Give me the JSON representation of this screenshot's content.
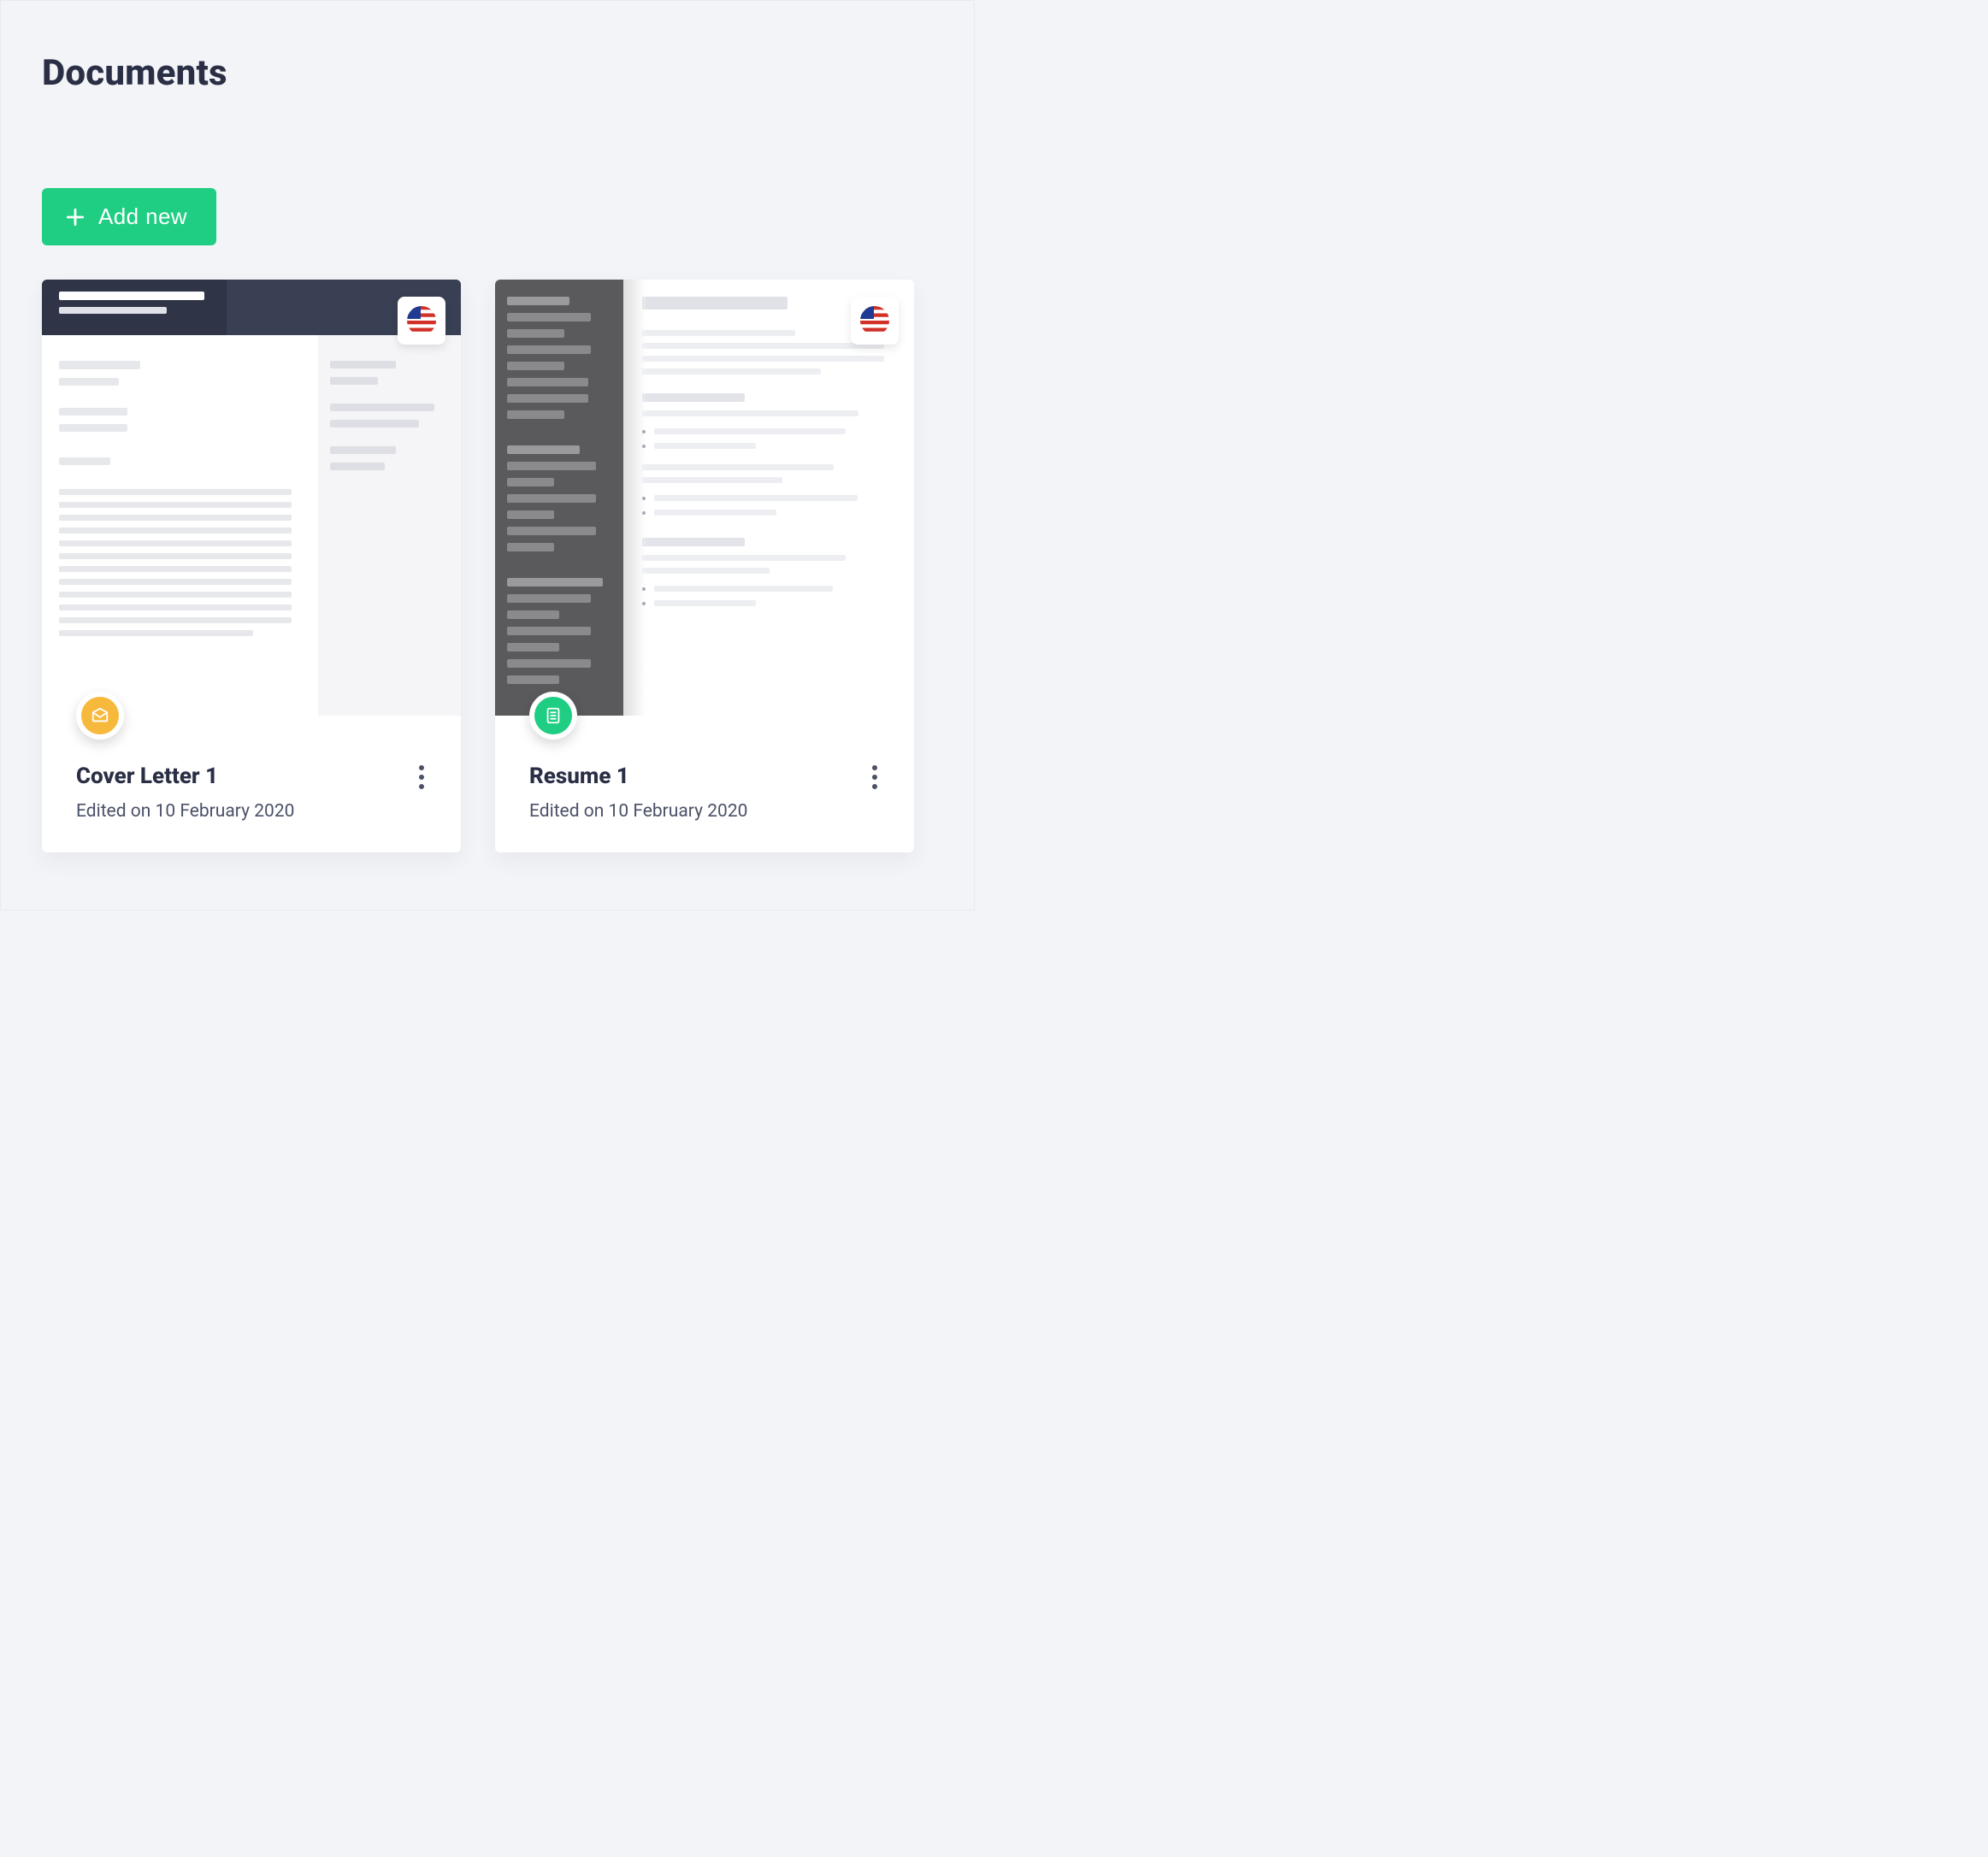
{
  "page": {
    "title": "Documents"
  },
  "actions": {
    "add_new_label": "Add new"
  },
  "documents": [
    {
      "type": "cover_letter",
      "title": "Cover Letter 1",
      "edited_label": "Edited on 10 February 2020",
      "locale_flag": "us"
    },
    {
      "type": "resume",
      "title": "Resume 1",
      "edited_label": "Edited on 10 February 2020",
      "locale_flag": "us"
    }
  ]
}
